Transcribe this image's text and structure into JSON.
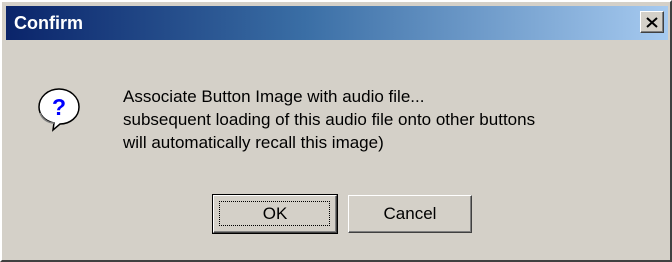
{
  "dialog": {
    "title": "Confirm",
    "icon": "question-icon",
    "message_lines": [
      "Associate Button Image with audio file...",
      "subsequent loading of this audio file onto other buttons",
      "will automatically recall this image)"
    ],
    "buttons": {
      "ok_label": "OK",
      "cancel_label": "Cancel"
    },
    "close_icon": "close-icon"
  },
  "colors": {
    "titlebar_start": "#0a246a",
    "titlebar_end": "#a6caf0",
    "face": "#d4d0c8",
    "icon_blue": "#0000ff"
  }
}
